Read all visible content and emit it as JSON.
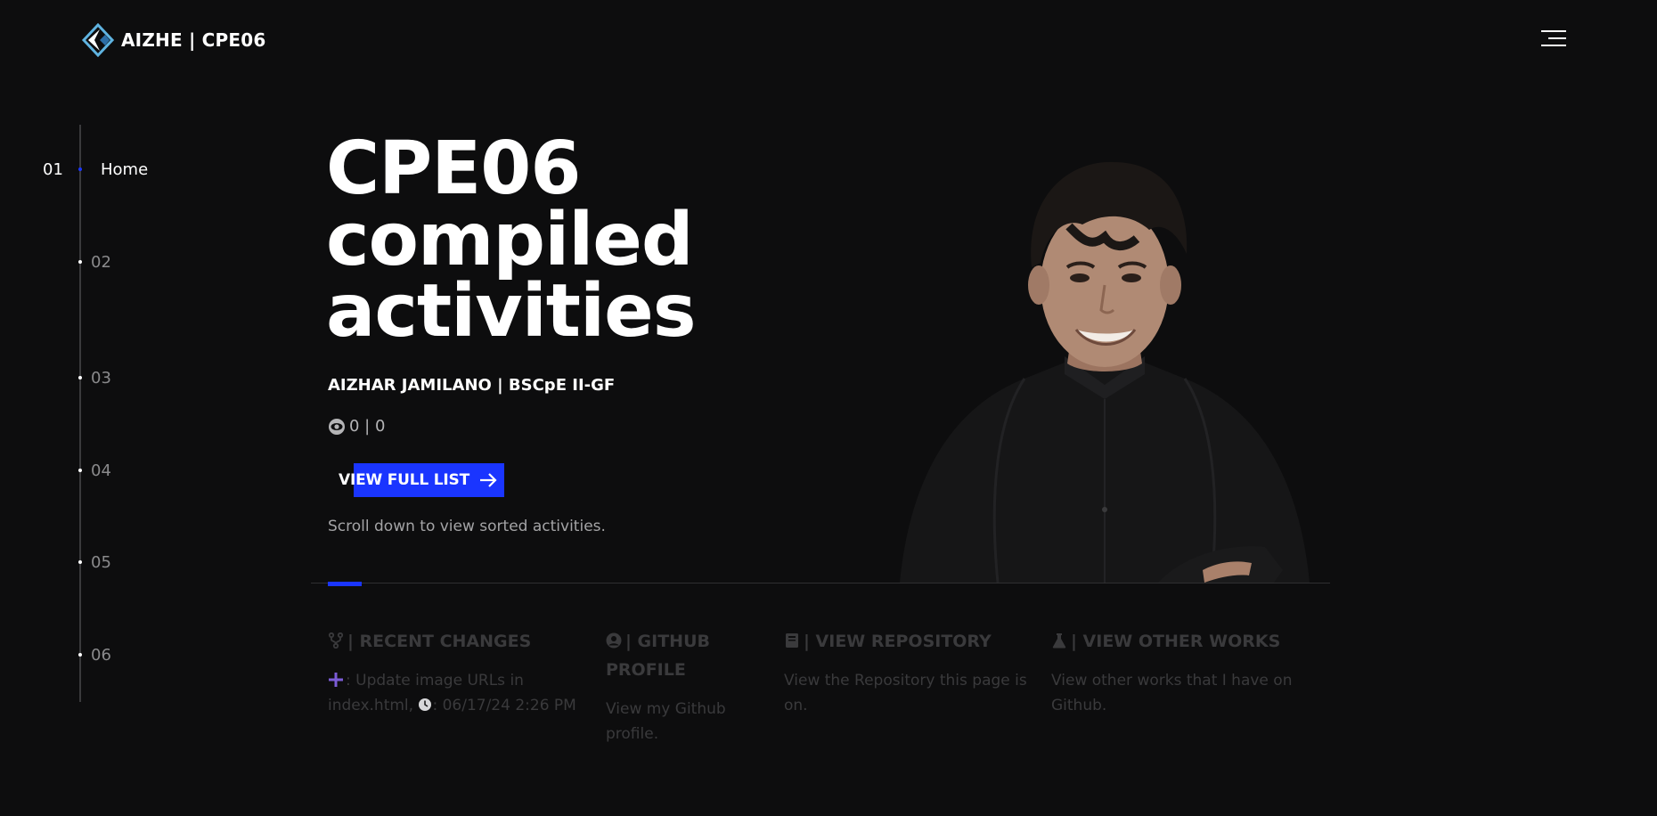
{
  "header": {
    "brand": "AIZHE | CPE06",
    "menu_icon": "hamburger-menu-icon"
  },
  "sidenav": {
    "active": {
      "number": "01",
      "label": "Home"
    },
    "items": [
      "02",
      "03",
      "04",
      "05",
      "06"
    ]
  },
  "hero": {
    "title_lines": [
      "CPE06",
      "compiled",
      "activities"
    ],
    "subtitle": "AIZHAR JAMILANO | BSCpE II-GF",
    "views": "0 | 0",
    "cta_label": "VIEW FULL LIST",
    "hint": "Scroll down to view sorted activities."
  },
  "cards": [
    {
      "icon": "git-fork-icon",
      "title": "| RECENT CHANGES",
      "body_a": ": Update image URLs in index.html,",
      "body_b": ": 06/17/24 2:26 PM"
    },
    {
      "icon": "user-circle-icon",
      "title": "| GITHUB PROFILE",
      "body": "View my Github profile."
    },
    {
      "icon": "book-icon",
      "title": "| VIEW REPOSITORY",
      "body": "View the Repository this page is on."
    },
    {
      "icon": "flask-icon",
      "title": "| VIEW OTHER WORKS",
      "body": "View other works that I have on Github."
    }
  ],
  "colors": {
    "background": "#0d0d0e",
    "accent": "#1a35ff",
    "muted": "#3a3a3c",
    "plus_icon": "#7b5cd6"
  }
}
